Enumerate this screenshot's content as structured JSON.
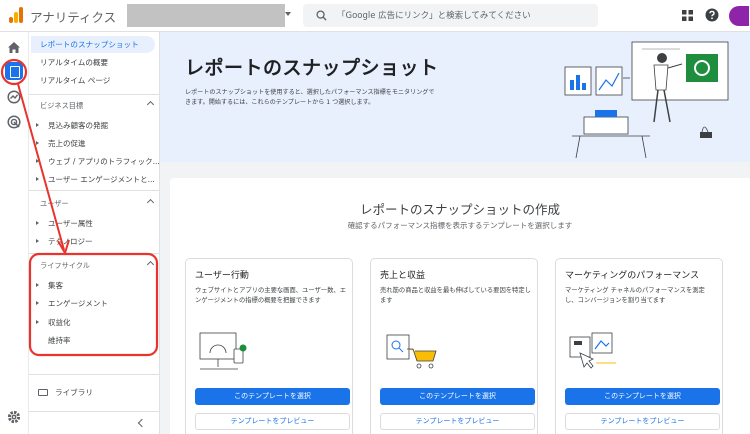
{
  "app": {
    "title": "アナリティクス"
  },
  "search": {
    "placeholder": "「Google 広告にリンク」と検索してみてください"
  },
  "sidebar": {
    "top_items": [
      {
        "label": "レポートのスナップショット",
        "active": true
      },
      {
        "label": "リアルタイムの概要"
      },
      {
        "label": "リアルタイム ページ"
      }
    ],
    "sections": [
      {
        "label": "ビジネス目標",
        "items": [
          "見込み顧客の発掘",
          "売上の促進",
          "ウェブ / アプリのトラフィック...",
          "ユーザー エンゲージメントと..."
        ]
      },
      {
        "label": "ユーザー",
        "items": [
          "ユーザー属性",
          "テクノロジー"
        ]
      },
      {
        "label": "ライフサイクル",
        "items": [
          "集客",
          "エンゲージメント",
          "収益化"
        ],
        "plain_items": [
          "維持率"
        ]
      }
    ],
    "library_label": "ライブラリ"
  },
  "hero": {
    "title": "レポートのスナップショット",
    "description": "レポートのスナップショットを使用すると、選択したパフォーマンス指標をモニタリングできます。開始するには、これらのテンプレートから 1 つ選択します。"
  },
  "panel": {
    "title": "レポートのスナップショットの作成",
    "subtitle": "確認するパフォーマンス指標を表示するテンプレートを選択します"
  },
  "cards": [
    {
      "title": "ユーザー行動",
      "description": "ウェブサイトとアプリの主要な画面、ユーザー数、エンゲージメントの指標の概要を把握できます",
      "select_label": "このテンプレートを選択",
      "preview_label": "テンプレートをプレビュー"
    },
    {
      "title": "売上と収益",
      "description": "売れ筋の商品と収益を最も伸ばしている要因を特定します",
      "select_label": "このテンプレートを選択",
      "preview_label": "テンプレートをプレビュー"
    },
    {
      "title": "マーケティングのパフォーマンス",
      "description": "マーケティング チャネルのパフォーマンスを測定し、コンバージョンを割り当てます",
      "select_label": "このテンプレートを選択",
      "preview_label": "テンプレートをプレビュー"
    }
  ],
  "colors": {
    "accent": "#1a73e8",
    "annotation": "#e8342c",
    "hero_bg": "#e8f0fe"
  },
  "icons": [
    "analytics-logo-icon",
    "search-icon",
    "apps-grid-icon",
    "help-icon",
    "home-icon",
    "reports-icon",
    "explore-icon",
    "advertising-icon",
    "settings-icon",
    "folder-icon"
  ]
}
